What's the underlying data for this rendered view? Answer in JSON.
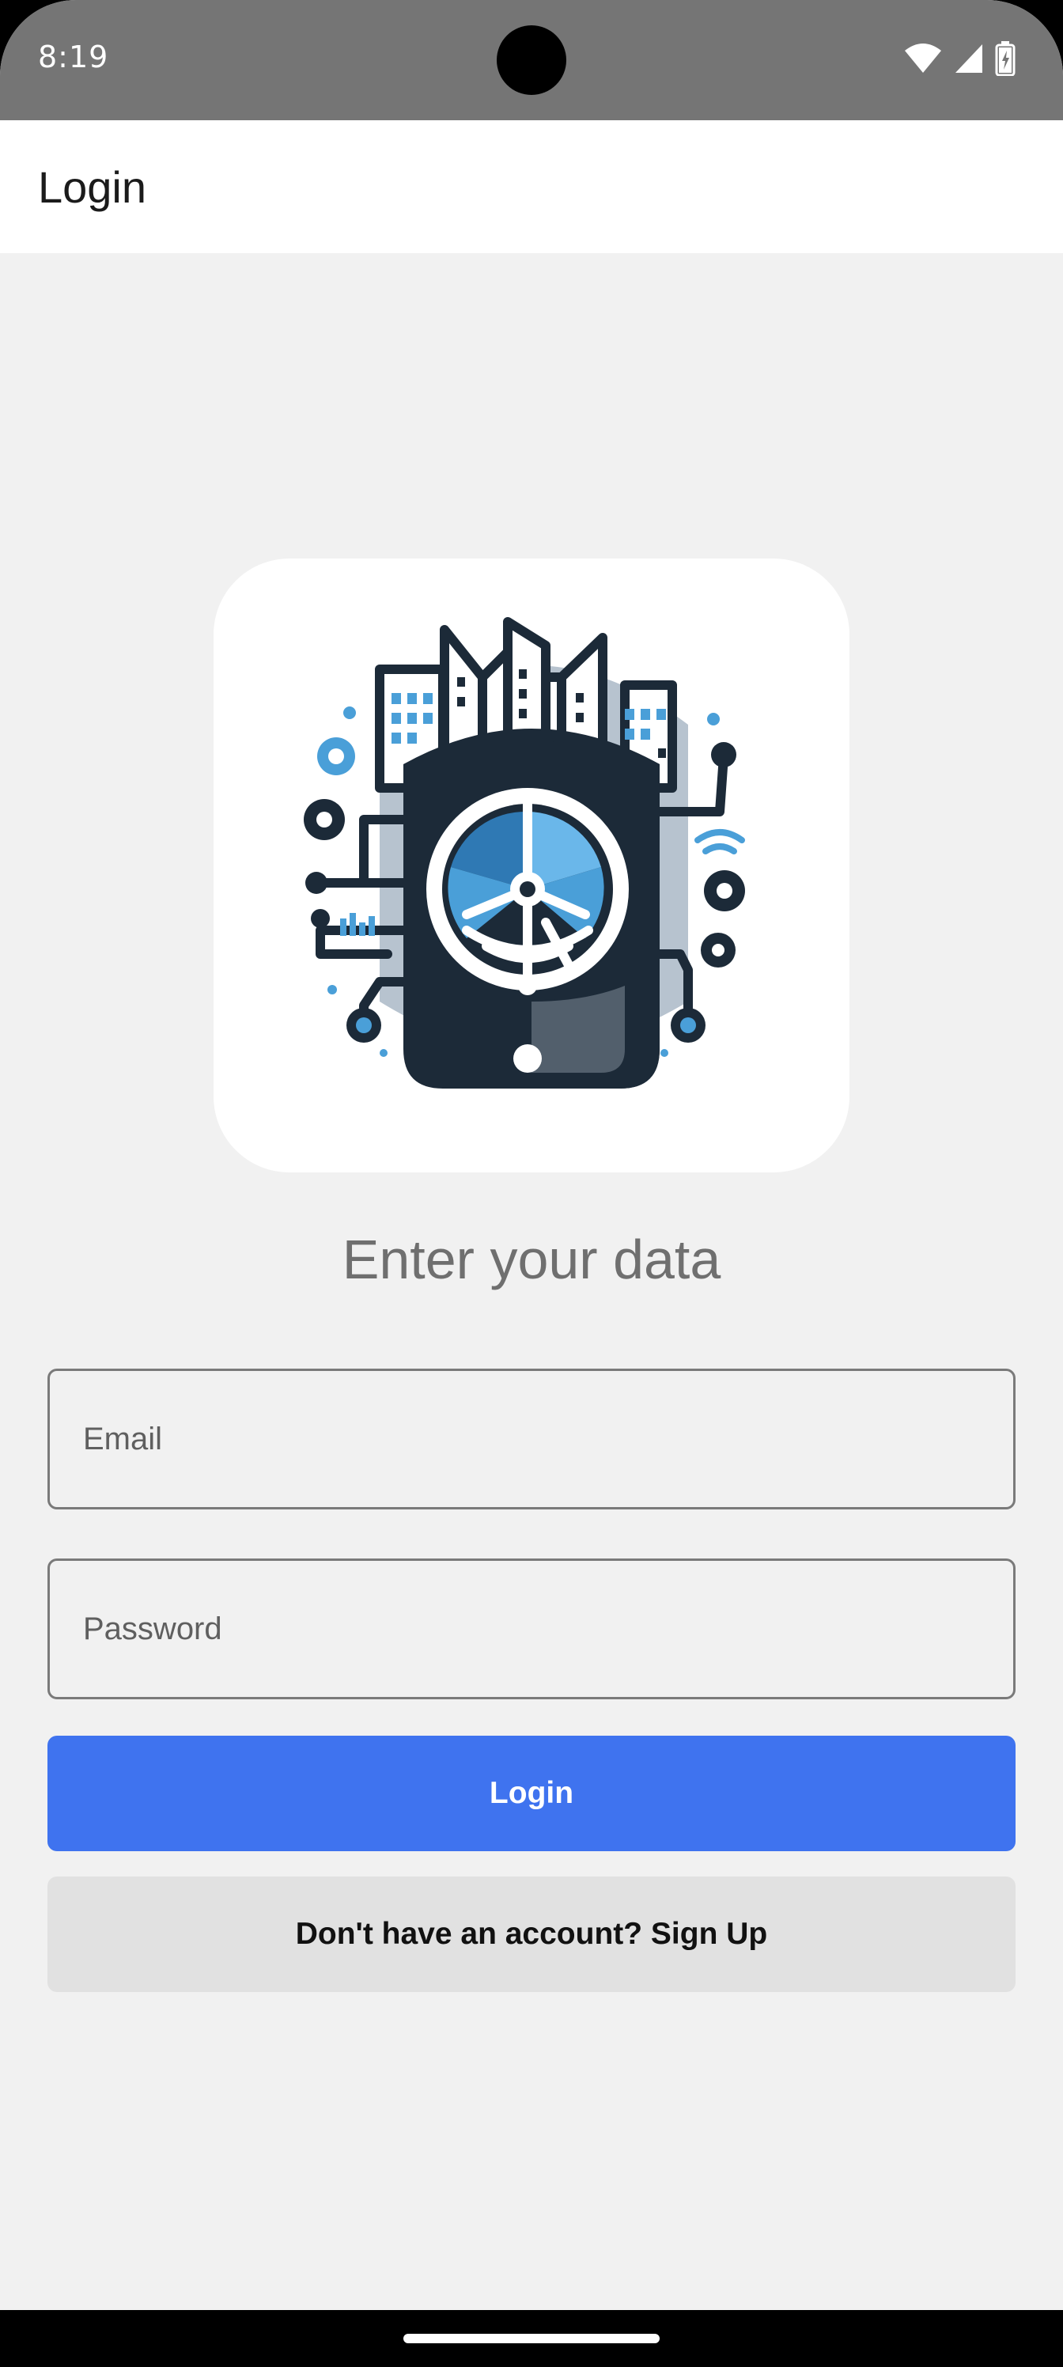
{
  "status_bar": {
    "time": "8:19",
    "icons": [
      "wifi-icon",
      "signal-icon",
      "battery-charging-icon"
    ]
  },
  "app_bar": {
    "title": "Login"
  },
  "logo": {
    "icon": "smart-city-tech-logo"
  },
  "form": {
    "subtitle": "Enter your data",
    "email_placeholder": "Email",
    "email_value": "",
    "password_placeholder": "Password",
    "password_value": "",
    "login_label": "Login",
    "signup_label": "Don't have an account? Sign Up"
  },
  "colors": {
    "status_bar": "#757575",
    "app_bar": "#ffffff",
    "background": "#f1f1f1",
    "primary_button": "#3f73ef",
    "secondary_button": "#e1e1e1",
    "logo_dark": "#1c2a38",
    "logo_accent": "#4a9fd8"
  }
}
